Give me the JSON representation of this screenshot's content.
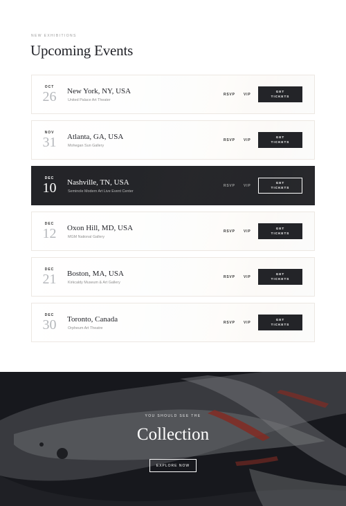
{
  "header": {
    "eyebrow": "NEW EXHIBITIONS",
    "title": "Upcoming Events"
  },
  "events": [
    {
      "month": "OCT",
      "day": "26",
      "city": "New York, NY, USA",
      "venue": "United Palace Art Theater",
      "rsvp": "RSVP",
      "vip": "VIP",
      "ticket_line1": "GET",
      "ticket_line2": "TICKETS",
      "style": "light"
    },
    {
      "month": "NOV",
      "day": "31",
      "city": "Atlanta, GA, USA",
      "venue": "Mohegan Sun Gallery",
      "rsvp": "RSVP",
      "vip": "VIP",
      "ticket_line1": "GET",
      "ticket_line2": "TICKETS",
      "style": "light"
    },
    {
      "month": "DEC",
      "day": "10",
      "city": "Nashville, TN, USA",
      "venue": "Seminole Modern Art Live Event Center",
      "rsvp": "RSVP",
      "vip": "VIP",
      "ticket_line1": "GET",
      "ticket_line2": "TICKETS",
      "style": "dark"
    },
    {
      "month": "DEC",
      "day": "12",
      "city": "Oxon Hill, MD, USA",
      "venue": "MGM National Gallery",
      "rsvp": "RSVP",
      "vip": "VIP",
      "ticket_line1": "GET",
      "ticket_line2": "TICKETS",
      "style": "light"
    },
    {
      "month": "DEC",
      "day": "21",
      "city": "Boston, MA, USA",
      "venue": "Kirkcaldy Museum & Art Gallery",
      "rsvp": "RSVP",
      "vip": "VIP",
      "ticket_line1": "GET",
      "ticket_line2": "TICKETS",
      "style": "light"
    },
    {
      "month": "DEC",
      "day": "30",
      "city": "Toronto, Canada",
      "venue": "Orpheum Art Theatre",
      "rsvp": "RSVP",
      "vip": "VIP",
      "ticket_line1": "GET",
      "ticket_line2": "TICKETS",
      "style": "light"
    }
  ],
  "collection": {
    "eyebrow": "YOU SHOULD SEE THE",
    "title": "Collection",
    "button": "EXPLORE NOW"
  },
  "colors": {
    "dark": "#232428",
    "accent_red": "#c0392b",
    "text_dark": "#1f2026"
  }
}
